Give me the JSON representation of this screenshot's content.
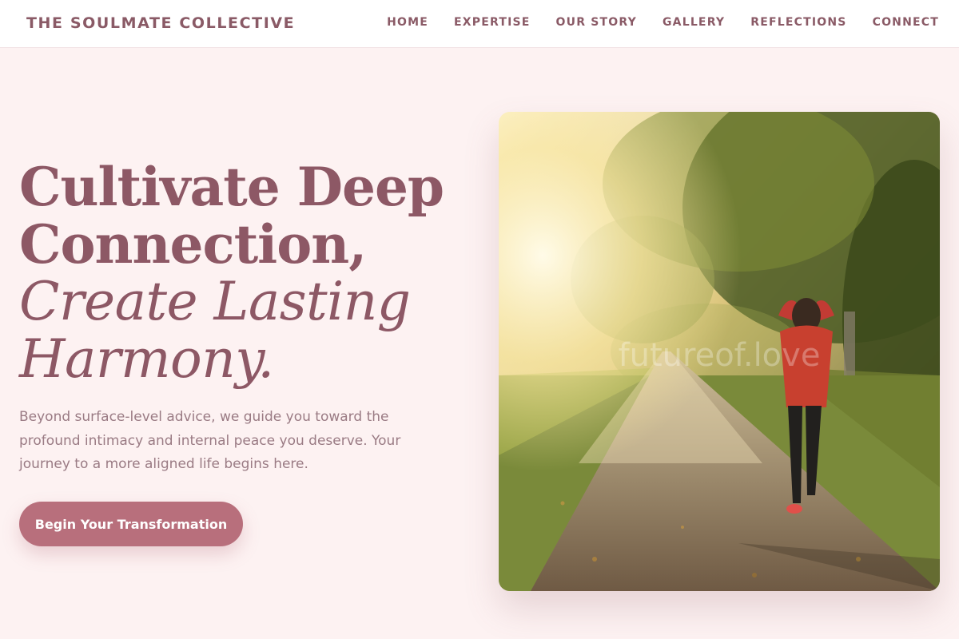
{
  "brand": "THE SOULMATE COLLECTIVE",
  "nav": [
    "HOME",
    "EXPERTISE",
    "OUR STORY",
    "GALLERY",
    "REFLECTIONS",
    "CONNECT"
  ],
  "hero": {
    "title_bold": [
      "Cultivate Deep",
      "Connection,"
    ],
    "title_italic": [
      "Create Lasting",
      "Harmony."
    ],
    "description": "Beyond surface-level advice, we guide you toward the profound intimacy and internal peace you deserve. Your journey to a more aligned life begins here.",
    "cta": "Begin Your Transformation"
  },
  "image": {
    "watermark": "futureof.love"
  },
  "colors": {
    "background": "#fdf2f2",
    "accent": "#b86f7c",
    "heading": "#8d5865",
    "body_text": "#9a7b84"
  }
}
